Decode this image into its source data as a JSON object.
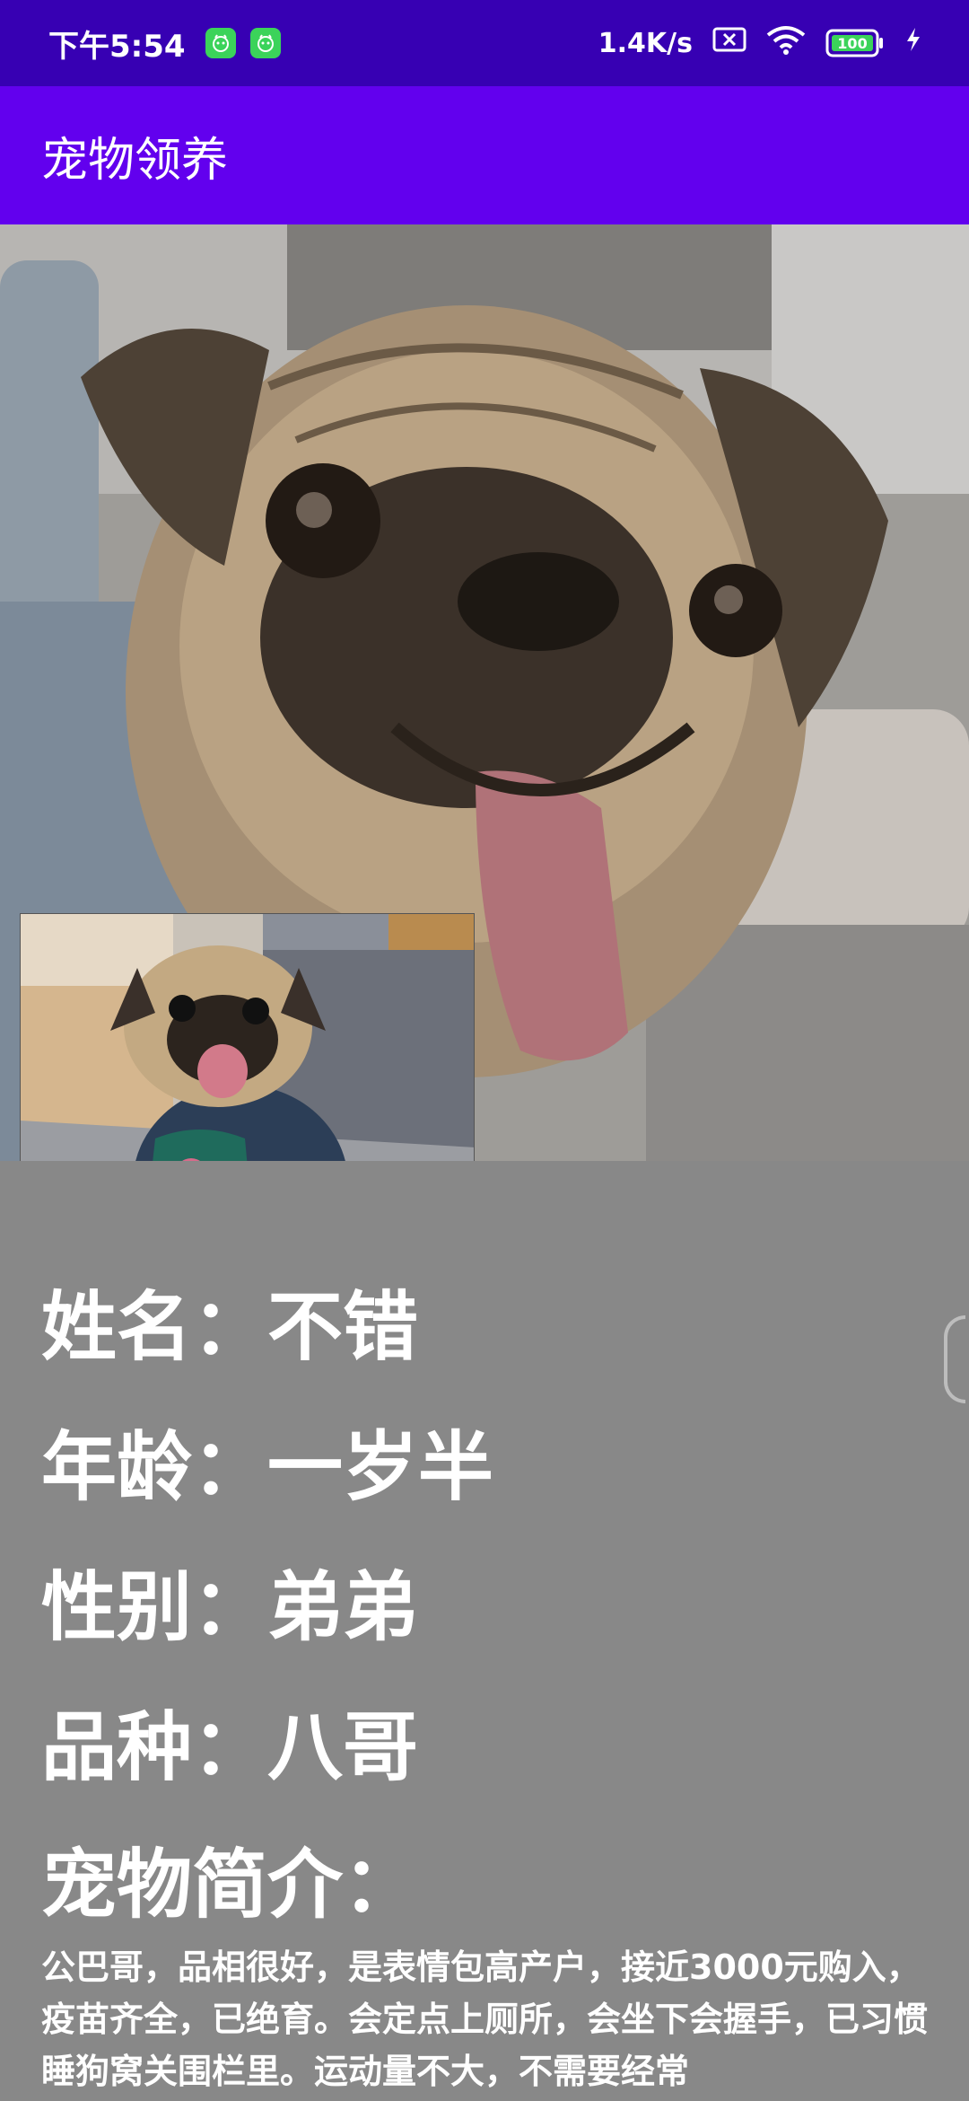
{
  "status_bar": {
    "time": "下午5:54",
    "net_speed": "1.4K/s",
    "battery": "100"
  },
  "toolbar": {
    "title": "宠物领养"
  },
  "pet": {
    "name_line": "姓名：不错",
    "age_line": "年龄：一岁半",
    "gender_line": "性别：弟弟",
    "breed_line": "品种：八哥",
    "intro_label": "宠物简介：",
    "intro_text": "公巴哥，品相很好，是表情包高产户，接近3000元购入，疫苗齐全，已绝育。会定点上厕所，会坐下会握手，已习惯睡狗窝关围栏里。运动量不大，不需要经常"
  },
  "icons": [
    "app-notification-icon",
    "sim-icon",
    "wifi-icon",
    "battery-icon",
    "charging-icon"
  ]
}
